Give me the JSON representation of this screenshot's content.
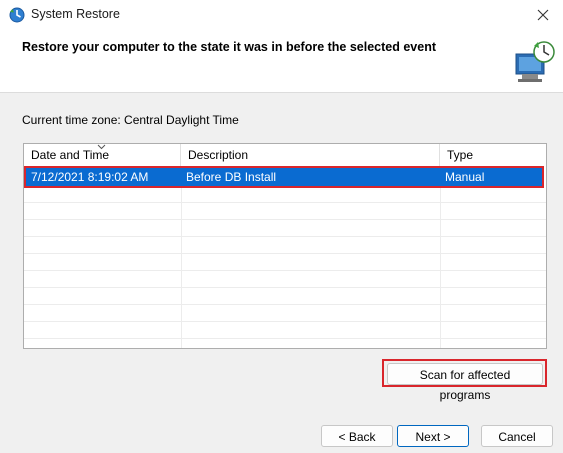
{
  "window": {
    "title": "System Restore"
  },
  "header": {
    "title": "Restore your computer to the state it was in before the selected event"
  },
  "timezone": {
    "label": "Current time zone: Central Daylight Time"
  },
  "table": {
    "columns": [
      "Date and Time",
      "Description",
      "Type"
    ],
    "sorted_column": "Date and Time",
    "rows": [
      {
        "datetime": "7/12/2021 8:19:02 AM",
        "description": "Before DB Install",
        "type": "Manual",
        "selected": true
      }
    ]
  },
  "buttons": {
    "scan": "Scan for affected programs",
    "back": "< Back",
    "next": "Next >",
    "cancel": "Cancel"
  },
  "colors": {
    "selection": "#0a6bd1",
    "highlight_outline": "#d9262c",
    "primary_border": "#0067c0"
  }
}
